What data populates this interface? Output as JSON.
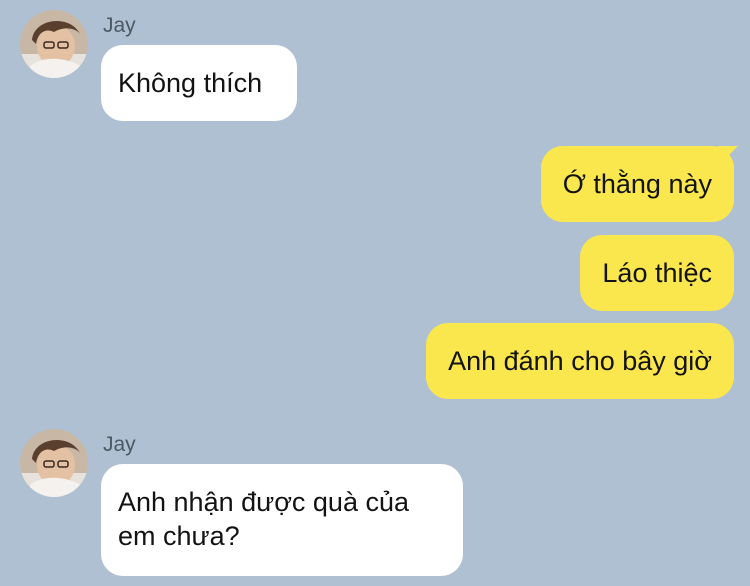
{
  "chat": {
    "background_color": "#aec0d1",
    "incoming_bubble_color": "#ffffff",
    "outgoing_bubble_color": "#fae74d",
    "messages": [
      {
        "direction": "in",
        "sender": "Jay",
        "text": "Không thích"
      },
      {
        "direction": "out",
        "text": "Ớ thằng này"
      },
      {
        "direction": "out",
        "text": "Láo thiệc"
      },
      {
        "direction": "out",
        "text": "Anh đánh cho bây giờ"
      },
      {
        "direction": "in",
        "sender": "Jay",
        "text_lines": [
          "Anh nhận được quà của",
          "em chưa?"
        ]
      }
    ]
  }
}
